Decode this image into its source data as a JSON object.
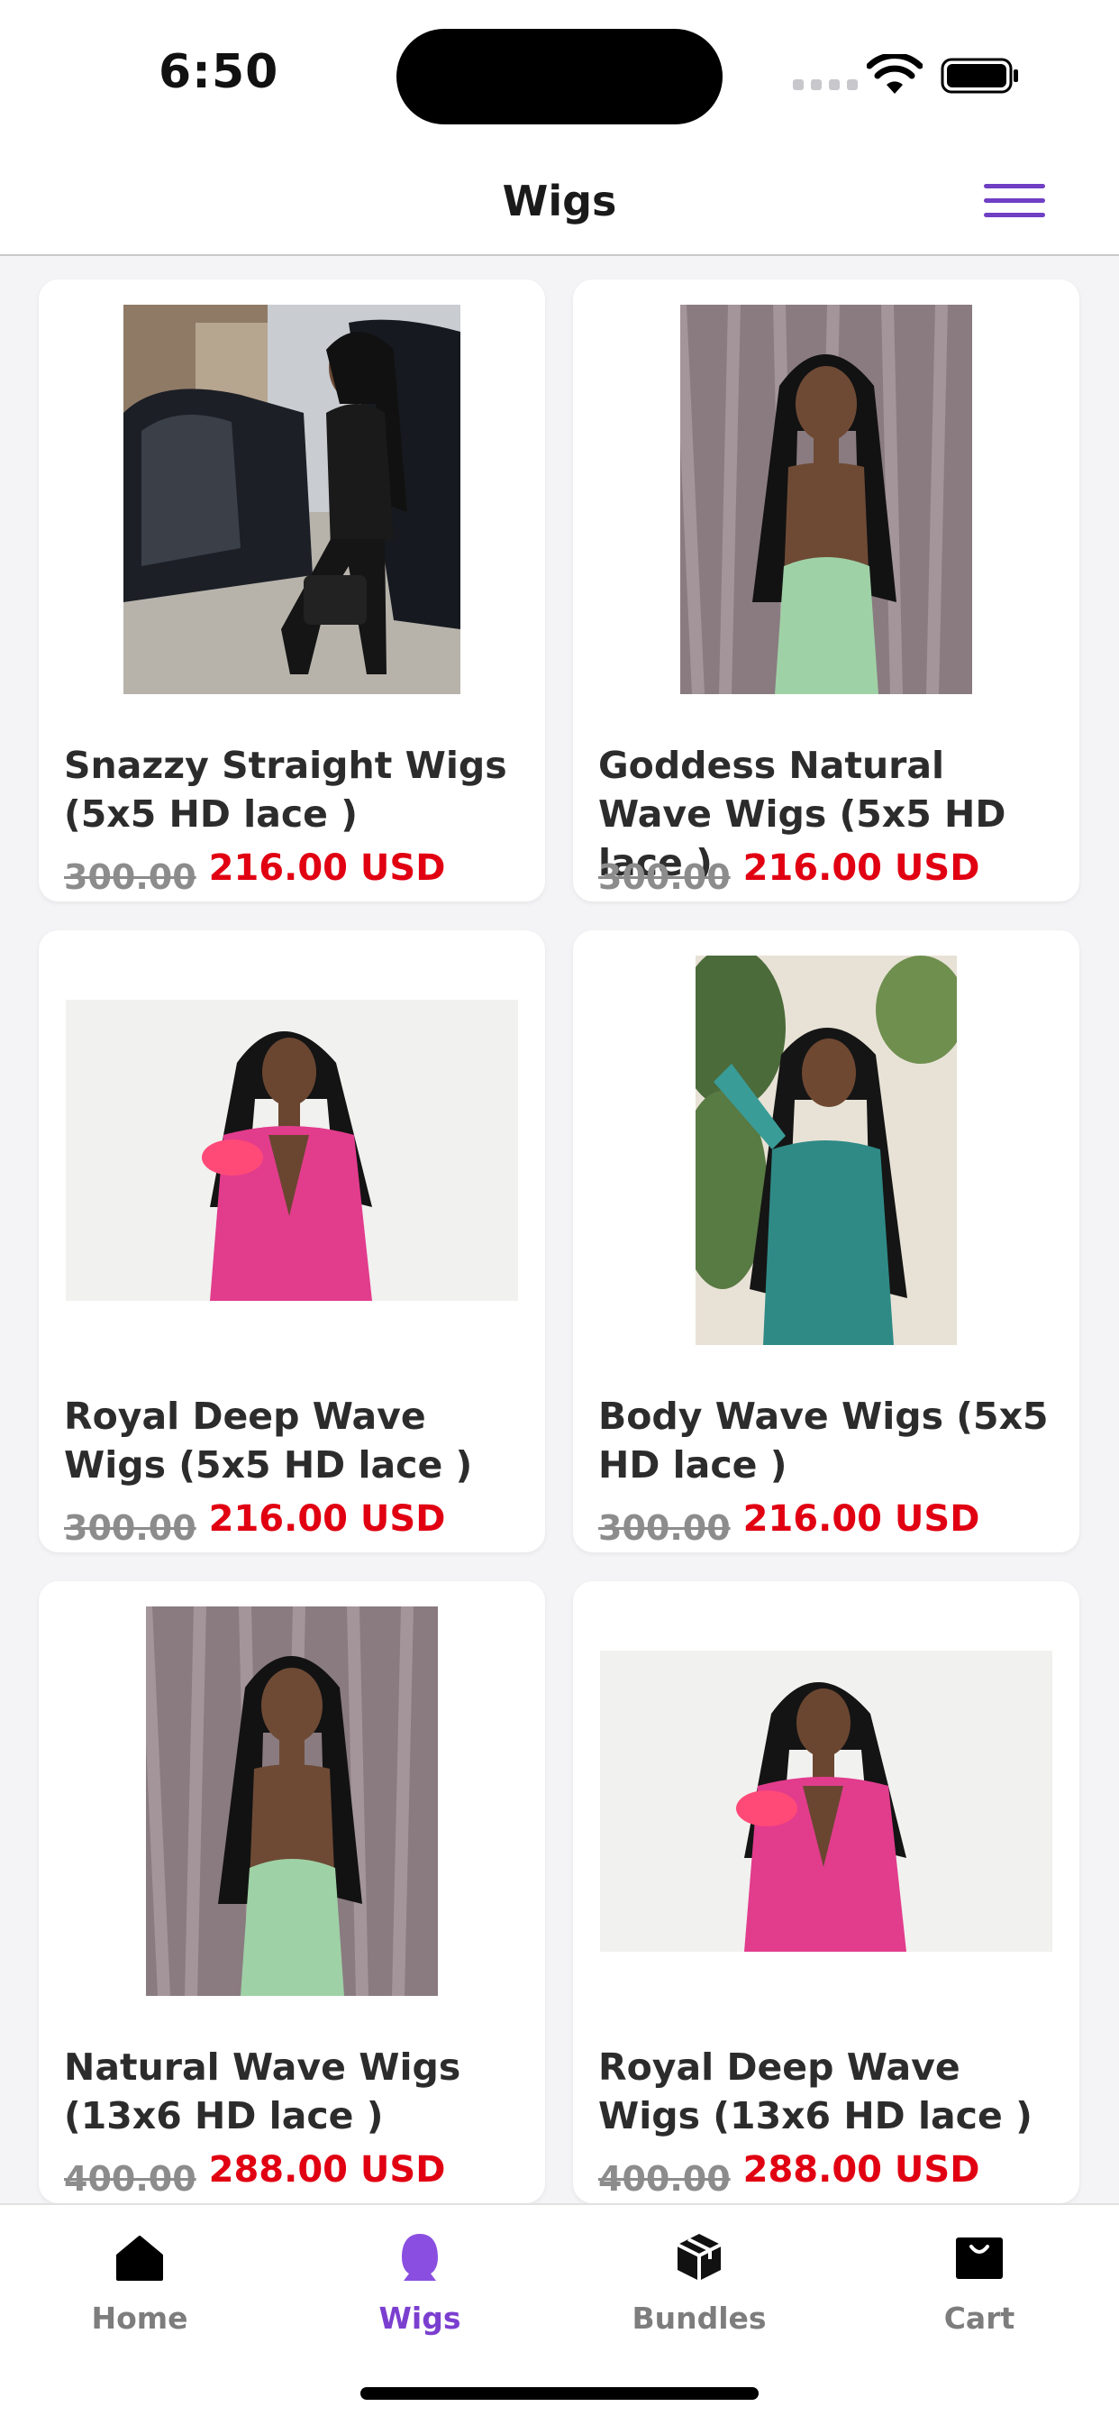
{
  "status_bar": {
    "time": "6:50"
  },
  "header": {
    "title": "Wigs",
    "menu_icon": "hamburger-menu-icon",
    "accent": "#6f3fc4"
  },
  "products": [
    {
      "name": "Snazzy Straight Wigs (5x5 HD lace )",
      "old_price": "300.00",
      "price": "216.00 USD"
    },
    {
      "name": "Goddess Natural Wave Wigs (5x5 HD lace )",
      "old_price": "300.00",
      "price": "216.00 USD"
    },
    {
      "name": "Royal Deep Wave Wigs (5x5 HD lace )",
      "old_price": "300.00",
      "price": "216.00 USD"
    },
    {
      "name": "Body Wave Wigs (5x5 HD lace )",
      "old_price": "300.00",
      "price": "216.00 USD"
    },
    {
      "name": "Natural Wave Wigs (13x6 HD lace )",
      "old_price": "400.00",
      "price": "288.00 USD"
    },
    {
      "name": "Royal Deep Wave Wigs (13x6 HD lace )",
      "old_price": "400.00",
      "price": "288.00 USD"
    }
  ],
  "tab_bar": {
    "tabs": [
      {
        "label": "Home",
        "icon": "home-icon"
      },
      {
        "label": "Wigs",
        "icon": "wig-icon",
        "active": true
      },
      {
        "label": "Bundles",
        "icon": "box-icon"
      },
      {
        "label": "Cart",
        "icon": "shopping-bag-icon"
      }
    ]
  },
  "colors": {
    "sale_price": "#e10012",
    "active_tab": "#7b3fd0",
    "old_price": "#8c8c8c"
  }
}
